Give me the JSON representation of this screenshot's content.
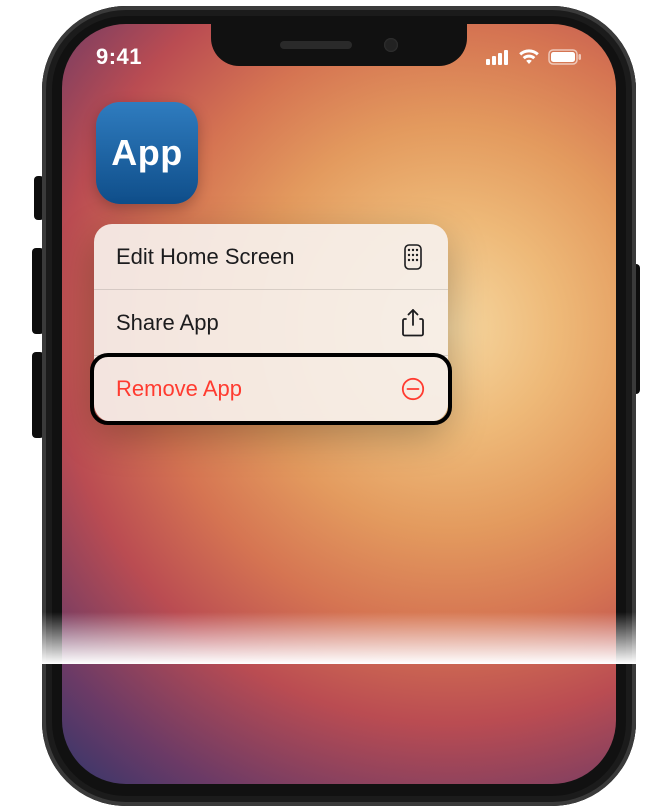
{
  "status": {
    "time": "9:41"
  },
  "app": {
    "label": "App"
  },
  "menu": {
    "items": [
      {
        "label": "Edit Home Screen",
        "icon": "homescreen-icon",
        "destructive": false
      },
      {
        "label": "Share App",
        "icon": "share-icon",
        "destructive": false
      },
      {
        "label": "Remove App",
        "icon": "remove-icon",
        "destructive": true
      }
    ]
  }
}
